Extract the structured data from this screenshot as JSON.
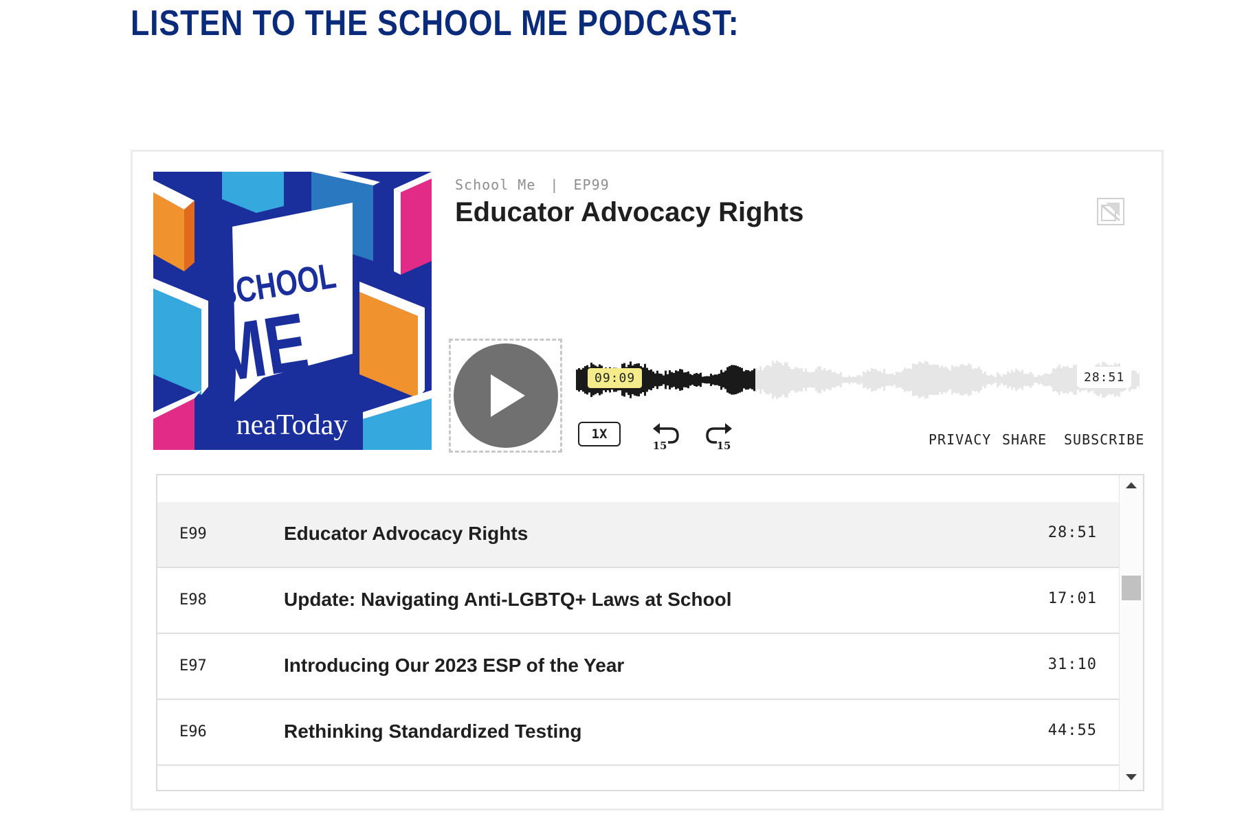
{
  "heading": "LISTEN TO THE SCHOOL ME PODCAST:",
  "player": {
    "show_name": "School Me",
    "separator": "|",
    "episode_code": "EP99",
    "episode_title": "Educator Advocacy Rights",
    "artwork": {
      "line1": "SCHOOL",
      "line2": "ME",
      "brand": "neaToday",
      "background_color": "#1a2f9c"
    },
    "elapsed": "09:09",
    "total": "28:51",
    "progress": 0.317,
    "speed_label": "1X",
    "skip_back_label": "15",
    "skip_forward_label": "15",
    "links": {
      "privacy": "PRIVACY",
      "share": "SHARE",
      "subscribe": "SUBSCRIBE"
    },
    "icons": {
      "play": "play-icon",
      "logo": "podcast-logo-icon"
    },
    "colors": {
      "heading": "#0a2a7a",
      "waveform_played": "#1a1a1a",
      "waveform_unplayed": "#e6e6e6",
      "elapsed_badge": "#f4ec8b",
      "play_button": "#707070"
    }
  },
  "episodes": [
    {
      "num": "E99",
      "title": "Educator Advocacy Rights",
      "duration": "28:51",
      "active": true
    },
    {
      "num": "E98",
      "title": "Update: Navigating Anti-LGBTQ+ Laws at School",
      "duration": "17:01",
      "active": false
    },
    {
      "num": "E97",
      "title": "Introducing Our 2023 ESP of the Year",
      "duration": "31:10",
      "active": false
    },
    {
      "num": "E96",
      "title": "Rethinking Standardized Testing",
      "duration": "44:55",
      "active": false
    }
  ]
}
